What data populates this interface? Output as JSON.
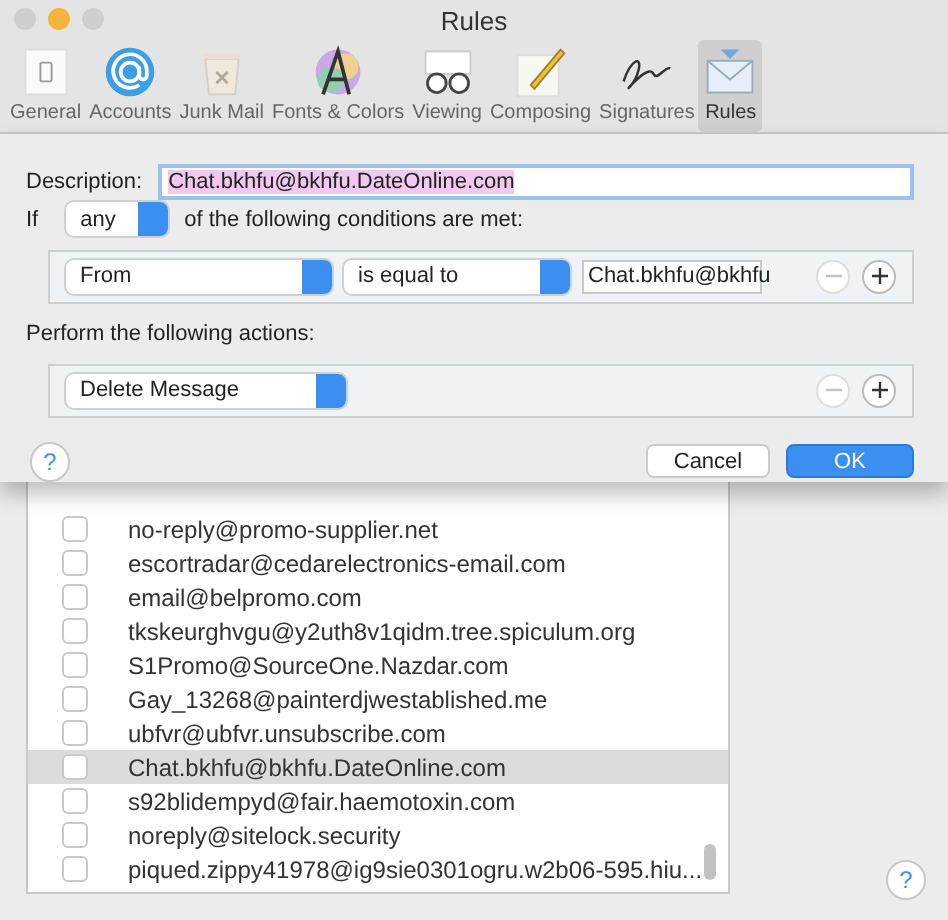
{
  "window": {
    "title": "Rules"
  },
  "toolbar": [
    {
      "label": "General",
      "selected": false
    },
    {
      "label": "Accounts",
      "selected": false
    },
    {
      "label": "Junk Mail",
      "selected": false
    },
    {
      "label": "Fonts & Colors",
      "selected": false
    },
    {
      "label": "Viewing",
      "selected": false
    },
    {
      "label": "Composing",
      "selected": false
    },
    {
      "label": "Signatures",
      "selected": false
    },
    {
      "label": "Rules",
      "selected": true
    }
  ],
  "sheet": {
    "description_label": "Description:",
    "description_value": "Chat.bkhfu@bkhfu.DateOnline.com",
    "description_text_selected": true,
    "if_label": "If",
    "match_popup": "any",
    "conditions_label": "of the following conditions are met:",
    "conditions": [
      {
        "field": "From",
        "operator": "is equal to",
        "value": "Chat.bkhfu@bkhfu",
        "remove_disabled": true
      }
    ],
    "actions_label": "Perform the following actions:",
    "actions": [
      {
        "action": "Delete Message",
        "remove_disabled": true
      }
    ],
    "help": "?",
    "cancel": "Cancel",
    "ok": "OK"
  },
  "window_help": "?",
  "list": [
    {
      "address": "no-reply@promo-supplier.net",
      "checked": false,
      "selected": false
    },
    {
      "address": "escortradar@cedarelectronics-email.com",
      "checked": false,
      "selected": false
    },
    {
      "address": "email@belpromo.com",
      "checked": false,
      "selected": false
    },
    {
      "address": "tkskeurghvgu@y2uth8v1qidm.tree.spiculum.org",
      "checked": false,
      "selected": false
    },
    {
      "address": "S1Promo@SourceOne.Nazdar.com",
      "checked": false,
      "selected": false
    },
    {
      "address": "Gay_13268@painterdjwestablished.me",
      "checked": false,
      "selected": false
    },
    {
      "address": "ubfvr@ubfvr.unsubscribe.com",
      "checked": false,
      "selected": false
    },
    {
      "address": "Chat.bkhfu@bkhfu.DateOnline.com",
      "checked": false,
      "selected": true
    },
    {
      "address": "s92blidempyd@fair.haemotoxin.com",
      "checked": false,
      "selected": false
    },
    {
      "address": "noreply@sitelock.security",
      "checked": false,
      "selected": false
    },
    {
      "address": "piqued.zippy41978@ig9sie0301ogru.w2b06-595.hiu...",
      "checked": false,
      "selected": false
    }
  ]
}
